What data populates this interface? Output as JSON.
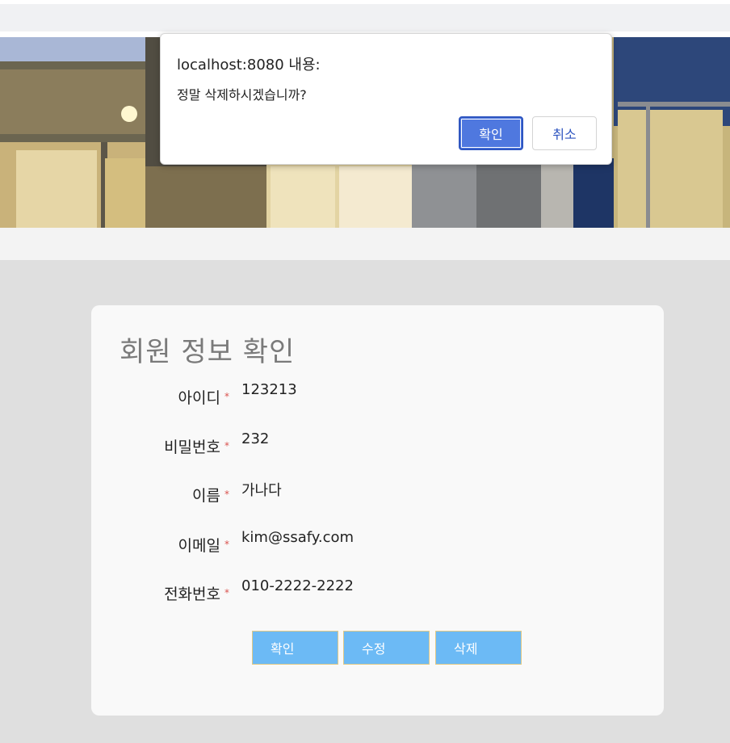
{
  "dialog": {
    "title": "localhost:8080 내용:",
    "message": "정말 삭제하시겠습니까?",
    "ok_label": "확인",
    "cancel_label": "취소"
  },
  "card": {
    "title": "회원 정보 확인",
    "required_mark": "*",
    "fields": [
      {
        "label": "아이디",
        "value": "123213"
      },
      {
        "label": "비밀번호",
        "value": "232"
      },
      {
        "label": "이름",
        "value": "가나다"
      },
      {
        "label": "이메일",
        "value": "kim@ssafy.com"
      },
      {
        "label": "전화번호",
        "value": "010-2222-2222"
      }
    ],
    "buttons": {
      "confirm": "확인",
      "edit": "수정",
      "delete": "삭제"
    }
  },
  "colors": {
    "button_bg": "#6cbaf5",
    "dialog_accent": "#4f78df"
  }
}
